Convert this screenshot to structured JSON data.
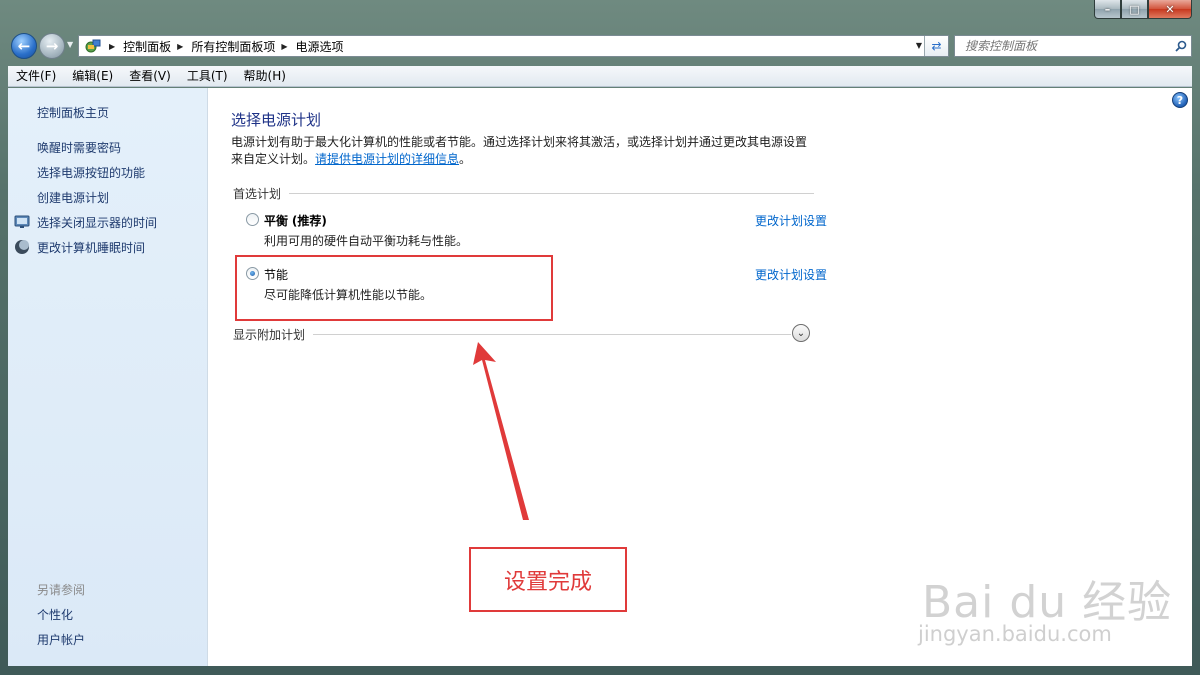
{
  "window": {
    "min_glyph": "–",
    "max_glyph": "□",
    "close_glyph": "✕"
  },
  "address": {
    "crumbs": [
      "控制面板",
      "所有控制面板项",
      "电源选项"
    ]
  },
  "search": {
    "placeholder": "搜索控制面板"
  },
  "menu": [
    "文件(F)",
    "编辑(E)",
    "查看(V)",
    "工具(T)",
    "帮助(H)"
  ],
  "sidebar": {
    "home": "控制面板主页",
    "links": [
      "唤醒时需要密码",
      "选择电源按钮的功能",
      "创建电源计划",
      "选择关闭显示器的时间",
      "更改计算机睡眠时间"
    ],
    "see_also_title": "另请参阅",
    "see_also": [
      "个性化",
      "用户帐户"
    ]
  },
  "main": {
    "title": "选择电源计划",
    "description_line1": "电源计划有助于最大化计算机的性能或者节能。通过选择计划来将其激活，或选择计划并通过更改其电源设置",
    "description_line2": "来自定义计划。",
    "description_link": "请提供电源计划的详细信息",
    "description_end": "。",
    "preferred_heading": "首选计划",
    "plans": [
      {
        "name": "平衡",
        "tag": "(推荐)",
        "desc": "利用可用的硬件自动平衡功耗与性能。",
        "link": "更改计划设置",
        "selected": false
      },
      {
        "name": "节能",
        "tag": "",
        "desc": "尽可能降低计算机性能以节能。",
        "link": "更改计划设置",
        "selected": true
      }
    ],
    "additional_heading": "显示附加计划",
    "help_glyph": "?"
  },
  "annotation": {
    "note": "设置完成",
    "color": "#e03a3a"
  },
  "watermark": {
    "main": "Bai du 经验",
    "sub": "jingyan.baidu.com"
  }
}
